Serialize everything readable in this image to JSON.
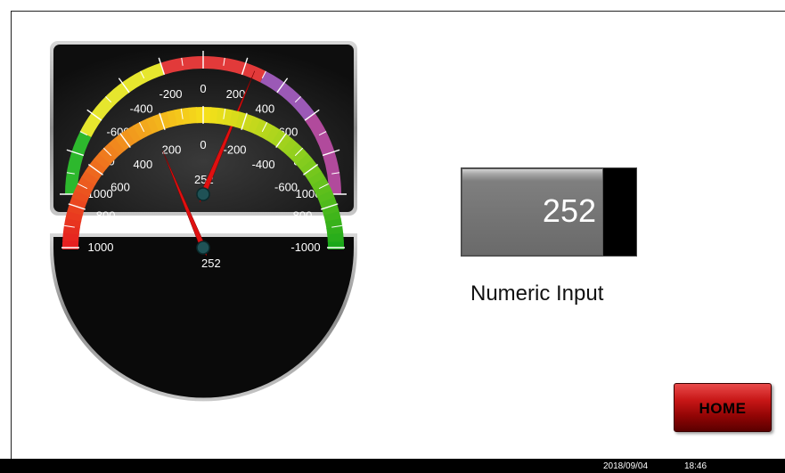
{
  "colors": {
    "gauge_body": "#1a1a1a",
    "gauge_rim": "#b5b5b5",
    "needle": "#e01010",
    "numeric_bg": "#737373",
    "home_button": "#b31010"
  },
  "gauge_top": {
    "min": -1000,
    "max": 1000,
    "value": 252,
    "value_label": "252",
    "tick_labels": [
      "-1000",
      "-800",
      "-600",
      "-400",
      "-200",
      "0",
      "200",
      "400",
      "600",
      "800",
      "1000"
    ],
    "bands": [
      {
        "from": -1000,
        "to": -700,
        "color": "#2db82d"
      },
      {
        "from": -700,
        "to": -200,
        "color": "#e6e62e"
      },
      {
        "from": -200,
        "to": 300,
        "color": "#e23a3a"
      },
      {
        "from": 300,
        "to": 600,
        "color": "#9b59b6"
      },
      {
        "from": 600,
        "to": 1000,
        "color": "#b14a9c"
      }
    ]
  },
  "gauge_bottom": {
    "min": -1000,
    "max": 1000,
    "value": 252,
    "value_label": "252",
    "tick_labels": [
      "1000",
      "800",
      "600",
      "400",
      "200",
      "0",
      "-200",
      "-400",
      "-600",
      "-800",
      "-1000"
    ],
    "gradient": [
      "#e62020",
      "#f0821e",
      "#f5e01a",
      "#8ccf1e",
      "#1aa81a"
    ]
  },
  "numeric_input": {
    "value": "252",
    "label": "Numeric Input"
  },
  "home_button": {
    "label": "HOME"
  },
  "status_bar": {
    "date": "2018/09/04",
    "time": "18:46"
  }
}
